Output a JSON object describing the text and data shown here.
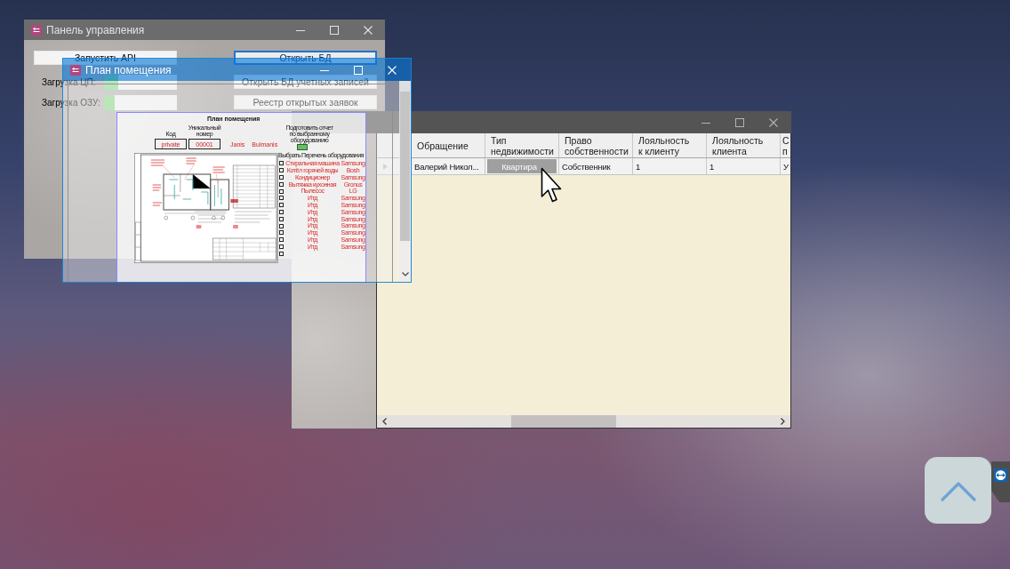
{
  "control_panel_window": {
    "title": "Панель управления",
    "active": false,
    "buttons": [
      {
        "label": "Запустить API",
        "focused": false
      },
      {
        "label": "Открыть БД",
        "focused": true
      },
      {
        "label": "Открыть БД учетных записей",
        "focused": false
      },
      {
        "label": "Реестр открытых заявок",
        "focused": false
      }
    ],
    "meters": [
      {
        "label": "Загрузка ЦП:",
        "level": 0.2
      },
      {
        "label": "Загрузка ОЗУ:",
        "level": 0.15
      }
    ]
  },
  "records_window": {
    "active": false,
    "table": {
      "columns": [
        "Обращение",
        "Тип недвижимости",
        "Право собственности",
        "Лояльность к клиенту",
        "Лояльность клиента",
        "С п"
      ],
      "rows": [
        {
          "current": true,
          "cells": [
            {
              "kind": "text",
              "text": "Валерий Никол..."
            },
            {
              "kind": "button",
              "text": "Квартира"
            },
            {
              "kind": "text",
              "text": "Собственник"
            },
            {
              "kind": "text",
              "text": "1"
            },
            {
              "kind": "text",
              "text": "1"
            },
            {
              "kind": "text",
              "text": "У"
            }
          ]
        }
      ]
    }
  },
  "plan_window": {
    "title": "План помещения",
    "active": true,
    "document": {
      "title": "План помещения",
      "fields": [
        {
          "label": "Код",
          "value": "private"
        },
        {
          "label": "Уникальный номер",
          "value": "00001"
        }
      ],
      "owner_names": [
        "Janis",
        "Bulmanis"
      ],
      "report_caption": "Подготовить отчет по выбранному оборудованию",
      "equipment_headers": [
        "Выбрать",
        "Перечень оборудования"
      ],
      "equipment": [
        {
          "name": "Стиральная машина",
          "brand": "Samsung",
          "checked": false
        },
        {
          "name": "Котёл горячей воды",
          "brand": "Bosh",
          "checked": false
        },
        {
          "name": "Кондиционер",
          "brand": "Samsung",
          "checked": false
        },
        {
          "name": "Вытяжка кухонная",
          "brand": "Gronus",
          "checked": false
        },
        {
          "name": "Пылесос",
          "brand": "LG",
          "checked": false
        },
        {
          "name": "Итд",
          "brand": "Samsung",
          "checked": false
        },
        {
          "name": "Итд",
          "brand": "Samsung",
          "checked": false
        },
        {
          "name": "Итд",
          "brand": "Samsung",
          "checked": false
        },
        {
          "name": "Итд",
          "brand": "Samsung",
          "checked": false
        },
        {
          "name": "Итд",
          "brand": "Samsung",
          "checked": false
        },
        {
          "name": "Итд",
          "brand": "Samsung",
          "checked": false
        },
        {
          "name": "Итд",
          "brand": "Samsung",
          "checked": false
        },
        {
          "name": "Итд",
          "brand": "Samsung",
          "checked": false
        },
        {
          "checked": false
        }
      ]
    }
  }
}
